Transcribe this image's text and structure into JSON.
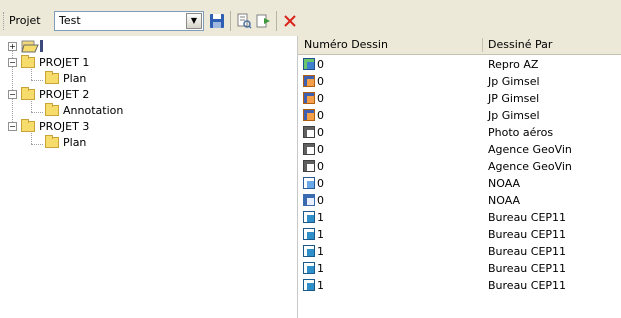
{
  "toolbar": {
    "projet_label": "Projet",
    "combo_value": "Test",
    "icons": [
      "save-icon",
      "search-documents-icon",
      "export-icon",
      "delete-x-icon"
    ]
  },
  "tree": {
    "root_icon": "open-folder-icon",
    "projects": [
      {
        "label": "PROJET 1",
        "children": [
          "Plan"
        ]
      },
      {
        "label": "PROJET 2",
        "children": [
          "Annotation"
        ]
      },
      {
        "label": "PROJET 3",
        "children": [
          "Plan"
        ]
      }
    ]
  },
  "list": {
    "headers": [
      "Numéro Dessin",
      "Dessiné Par"
    ],
    "rows": [
      {
        "num": "0",
        "by": "Repro AZ",
        "icon": "image-file-icon"
      },
      {
        "num": "0",
        "by": "Jp Gimsel",
        "icon": "drawing-file-icon"
      },
      {
        "num": "0",
        "by": "JP Gimsel",
        "icon": "drawing-file-icon"
      },
      {
        "num": "0",
        "by": "Jp Gimsel",
        "icon": "drawing-file-icon"
      },
      {
        "num": "0",
        "by": "Photo aéros",
        "icon": "photo-file-icon"
      },
      {
        "num": "0",
        "by": "Agence GeoVin",
        "icon": "photo-file-icon"
      },
      {
        "num": "0",
        "by": "Agence GeoVin",
        "icon": "photo-file-icon"
      },
      {
        "num": "0",
        "by": "NOAA",
        "icon": "map-file-icon"
      },
      {
        "num": "0",
        "by": "NOAA",
        "icon": "chart-file-icon"
      },
      {
        "num": "1",
        "by": "Bureau CEP11",
        "icon": "plan-file-icon"
      },
      {
        "num": "1",
        "by": "Bureau CEP11",
        "icon": "plan-file-icon"
      },
      {
        "num": "1",
        "by": "Bureau CEP11",
        "icon": "plan-file-icon"
      },
      {
        "num": "1",
        "by": "Bureau CEP11",
        "icon": "plan-file-icon"
      },
      {
        "num": "1",
        "by": "Bureau CEP11",
        "icon": "plan-file-icon"
      }
    ]
  },
  "colors": {
    "toolbar_bg": "#ece9d8",
    "folder": "#f5dc6b",
    "delete_red": "#d9251c",
    "save_blue": "#2f5fb3"
  }
}
